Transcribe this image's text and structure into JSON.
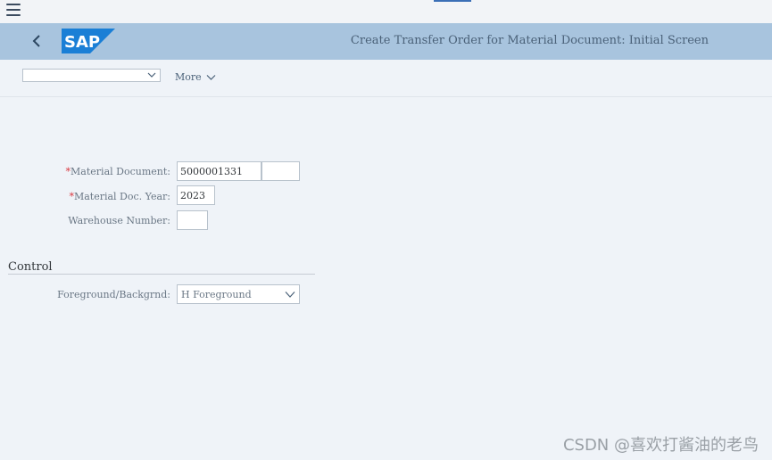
{
  "header": {
    "menu_icon": "hamburger-menu-icon",
    "back_icon": "chevron-left-icon",
    "logo_text": "SAP",
    "title": "Create Transfer Order for Material Document: Initial Screen"
  },
  "toolbar": {
    "dropdown_value": "",
    "more_label": "More"
  },
  "form": {
    "material_document": {
      "label": "Material Document:",
      "value": "5000001331",
      "extra_value": ""
    },
    "material_doc_year": {
      "label": "Material Doc. Year:",
      "value": "2023"
    },
    "warehouse_number": {
      "label": "Warehouse Number:",
      "value": ""
    }
  },
  "control": {
    "section_title": "Control",
    "foreground_label": "Foreground/Backgrnd:",
    "foreground_value": "H Foreground"
  },
  "watermark": "CSDN @喜欢打酱油的老鸟",
  "colors": {
    "shell_bar": "#a8c4de",
    "background": "#eff3f8",
    "required": "#d9363e",
    "logo_blue": "#1a7fd6"
  }
}
